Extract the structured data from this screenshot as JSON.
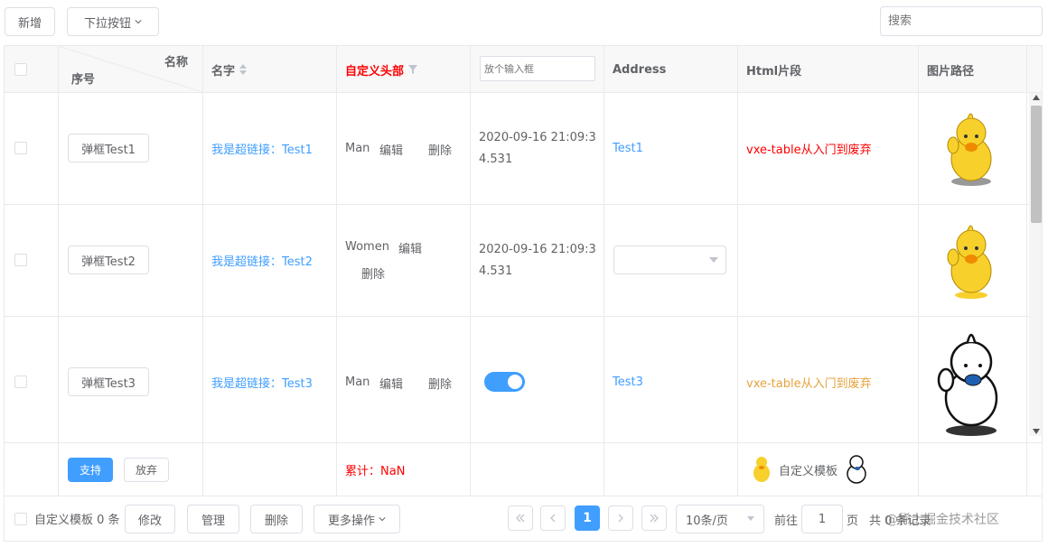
{
  "toolbar": {
    "add_label": "新增",
    "dropdown_label": "下拉按钮",
    "search_placeholder": "搜索"
  },
  "header": {
    "corner_top": "名称",
    "corner_bottom": "序号",
    "col_name": "名字",
    "col_custom": "自定义头部",
    "col_input_placeholder": "放个输入框",
    "col_address": "Address",
    "col_html": "Html片段",
    "col_image": "图片路径"
  },
  "rows": [
    {
      "button": "弹框Test1",
      "link": "我是超链接：Test1",
      "gender": "Man",
      "edit": "编辑",
      "delete": "删除",
      "date_line1": "2020-09-16 21:09:3",
      "date_line2": "4.531",
      "address": "Test1",
      "html": "vxe-table从入门到废弃"
    },
    {
      "button": "弹框Test2",
      "link": "我是超链接：Test2",
      "gender": "Women",
      "edit": "编辑",
      "delete": "删除",
      "date_line1": "2020-09-16 21:09:3",
      "date_line2": "4.531"
    },
    {
      "button": "弹框Test3",
      "link": "我是超链接：Test3",
      "gender": "Man",
      "edit": "编辑",
      "delete": "删除",
      "switch_on": true,
      "address": "Test3",
      "html": "vxe-table从入门到废弃"
    }
  ],
  "footer_row": {
    "support": "支持",
    "abandon": "放弃",
    "sum": "累计：NaN",
    "template": "自定义模板"
  },
  "bottom": {
    "template_text": "自定义模板 0 条",
    "modify": "修改",
    "manage": "管理",
    "delete": "删除",
    "more": "更多操作",
    "page_current": "1",
    "page_size": "10条/页",
    "goto_prefix": "前往",
    "goto_value": "1",
    "goto_suffix": "页",
    "total": "共 0 条记录",
    "watermark": "@稀土掘金技术社区"
  },
  "colors": {
    "primary": "#409eff",
    "red": "#ff0000",
    "orange": "#e6a23c",
    "duck": "#f7d02c"
  }
}
